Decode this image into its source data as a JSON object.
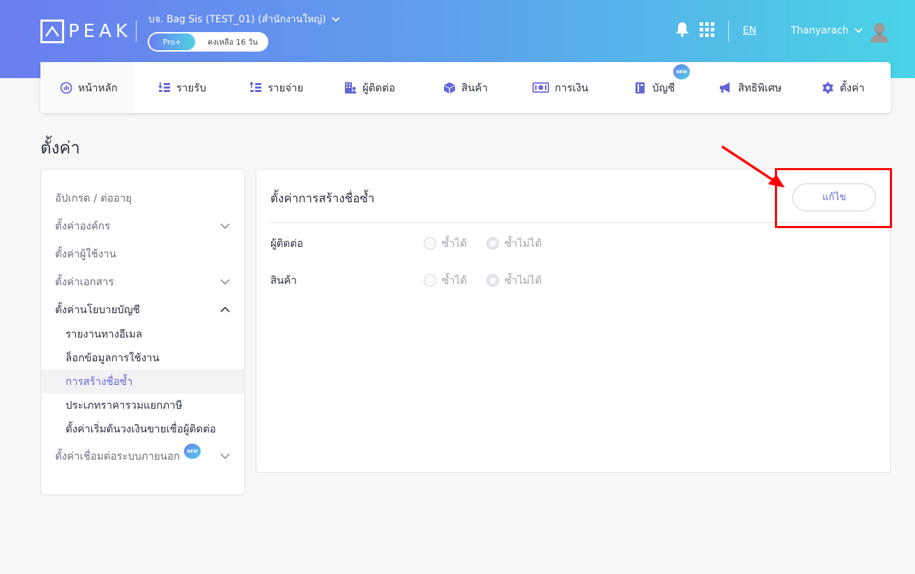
{
  "header": {
    "logo_text": "PEAK",
    "company_name": "บจ. Bag Sis (TEST_01) (สำนักงานใหญ่)",
    "plan_label": "Pro+",
    "plan_remaining": "คงเหลือ 16 วัน",
    "language": "EN",
    "username": "Thanyarach"
  },
  "nav": {
    "items": [
      {
        "label": "หน้าหลัก",
        "icon": "dashboard-icon"
      },
      {
        "label": "รายรับ",
        "icon": "income-icon"
      },
      {
        "label": "รายจ่าย",
        "icon": "expense-icon"
      },
      {
        "label": "ผู้ติดต่อ",
        "icon": "contacts-icon"
      },
      {
        "label": "สินค้า",
        "icon": "product-box-icon"
      },
      {
        "label": "การเงิน",
        "icon": "money-icon"
      },
      {
        "label": "บัญชี",
        "icon": "ledger-icon"
      },
      {
        "label": "สิทธิพิเศษ",
        "icon": "megaphone-icon"
      },
      {
        "label": "ตั้งค่า",
        "icon": "gear-icon"
      }
    ],
    "new_badge": "NEW"
  },
  "page": {
    "title": "ตั้งค่า"
  },
  "sidebar": {
    "items": [
      {
        "label": "อัปเกรด / ต่ออายุ"
      },
      {
        "label": "ตั้งค่าองค์กร"
      },
      {
        "label": "ตั้งค่าผู้ใช้งาน"
      },
      {
        "label": "ตั้งค่าเอกสาร"
      },
      {
        "label": "ตั้งค่านโยบายบัญชี"
      },
      {
        "label": "ตั้งค่าเชื่อมต่อระบบภายนอก"
      }
    ],
    "subitems": [
      {
        "label": "รายงานทางอีเมล"
      },
      {
        "label": "ล็อกข้อมูลการใช้งาน"
      },
      {
        "label": "การสร้างชื่อซ้ำ"
      },
      {
        "label": "ประเภทราคารวมแยกภาษี"
      },
      {
        "label": "ตั้งค่าเริ่มต้นวงเงินขายเชื่อผู้ติดต่อ"
      }
    ],
    "new_badge": "NEW"
  },
  "panel": {
    "title": "ตั้งค่าการสร้างชื่อซ้ำ",
    "edit_label": "แก้ไข",
    "rows": [
      {
        "label": "ผู้ติดต่อ",
        "option_allow": "ซ้ำได้",
        "option_deny": "ซ้ำไม่ได้",
        "selected": "deny"
      },
      {
        "label": "สินค้า",
        "option_allow": "ซ้ำได้",
        "option_deny": "ซ้ำไม่ได้",
        "selected": "deny"
      }
    ]
  },
  "colors": {
    "accent": "#6466d8",
    "annotation": "#ff0000"
  }
}
